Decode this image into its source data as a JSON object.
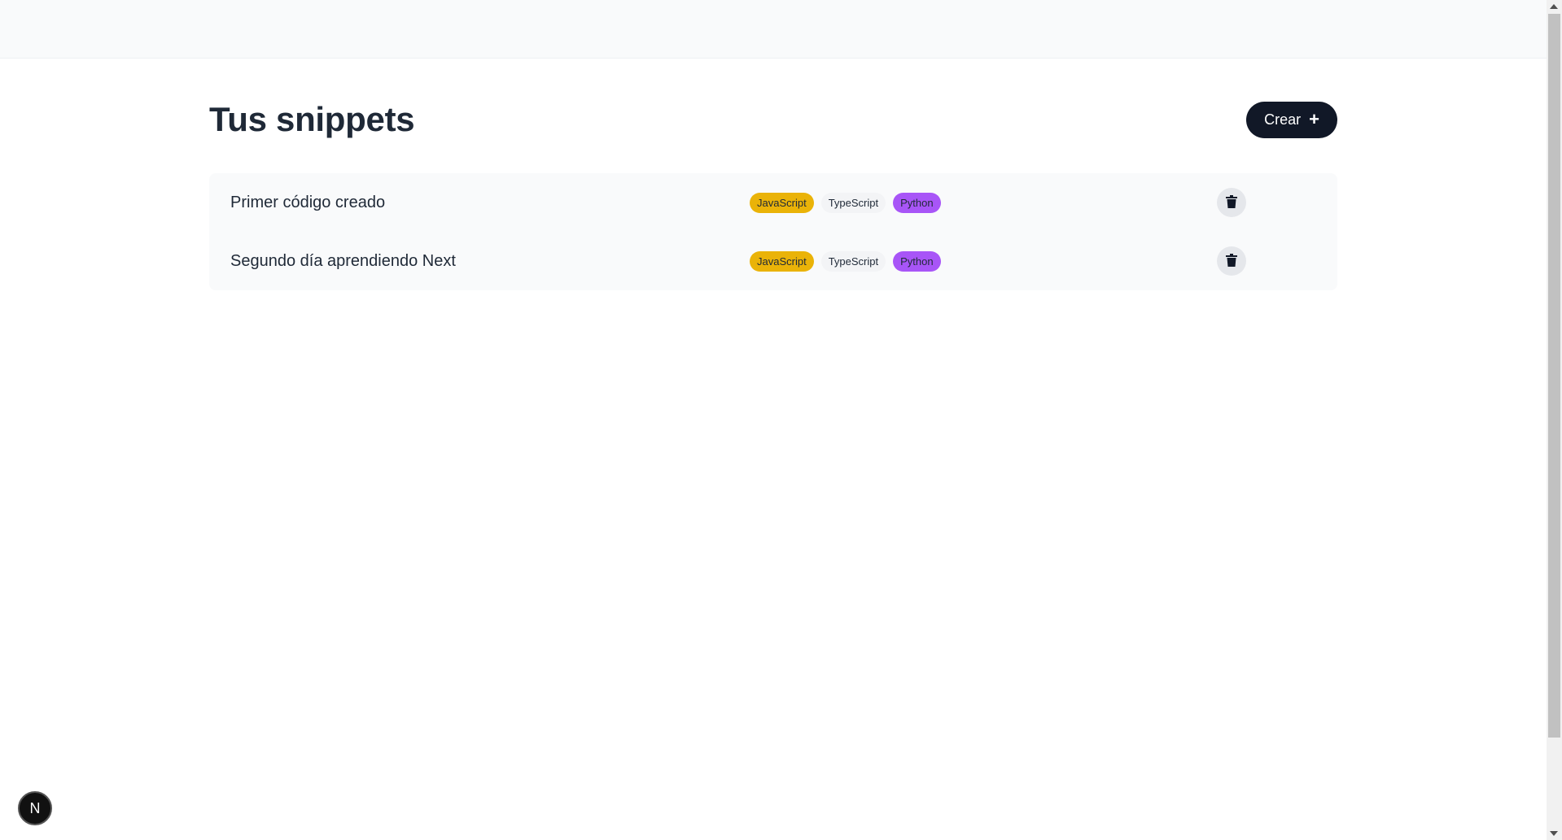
{
  "header": {
    "title": "Tus snippets",
    "create_label": "Crear"
  },
  "snippets": [
    {
      "title": "Primer código creado",
      "tags": [
        "JavaScript",
        "TypeScript",
        "Python"
      ]
    },
    {
      "title": "Segundo día aprendiendo Next",
      "tags": [
        "JavaScript",
        "TypeScript",
        "Python"
      ]
    }
  ],
  "dev_badge": {
    "label": "N"
  },
  "icons": {
    "create": "plus-icon",
    "delete": "trash-icon"
  },
  "colors": {
    "primary": "#111827",
    "javascript": "#eab308",
    "typescript": "#f3f4f6",
    "python": "#a855f7"
  }
}
